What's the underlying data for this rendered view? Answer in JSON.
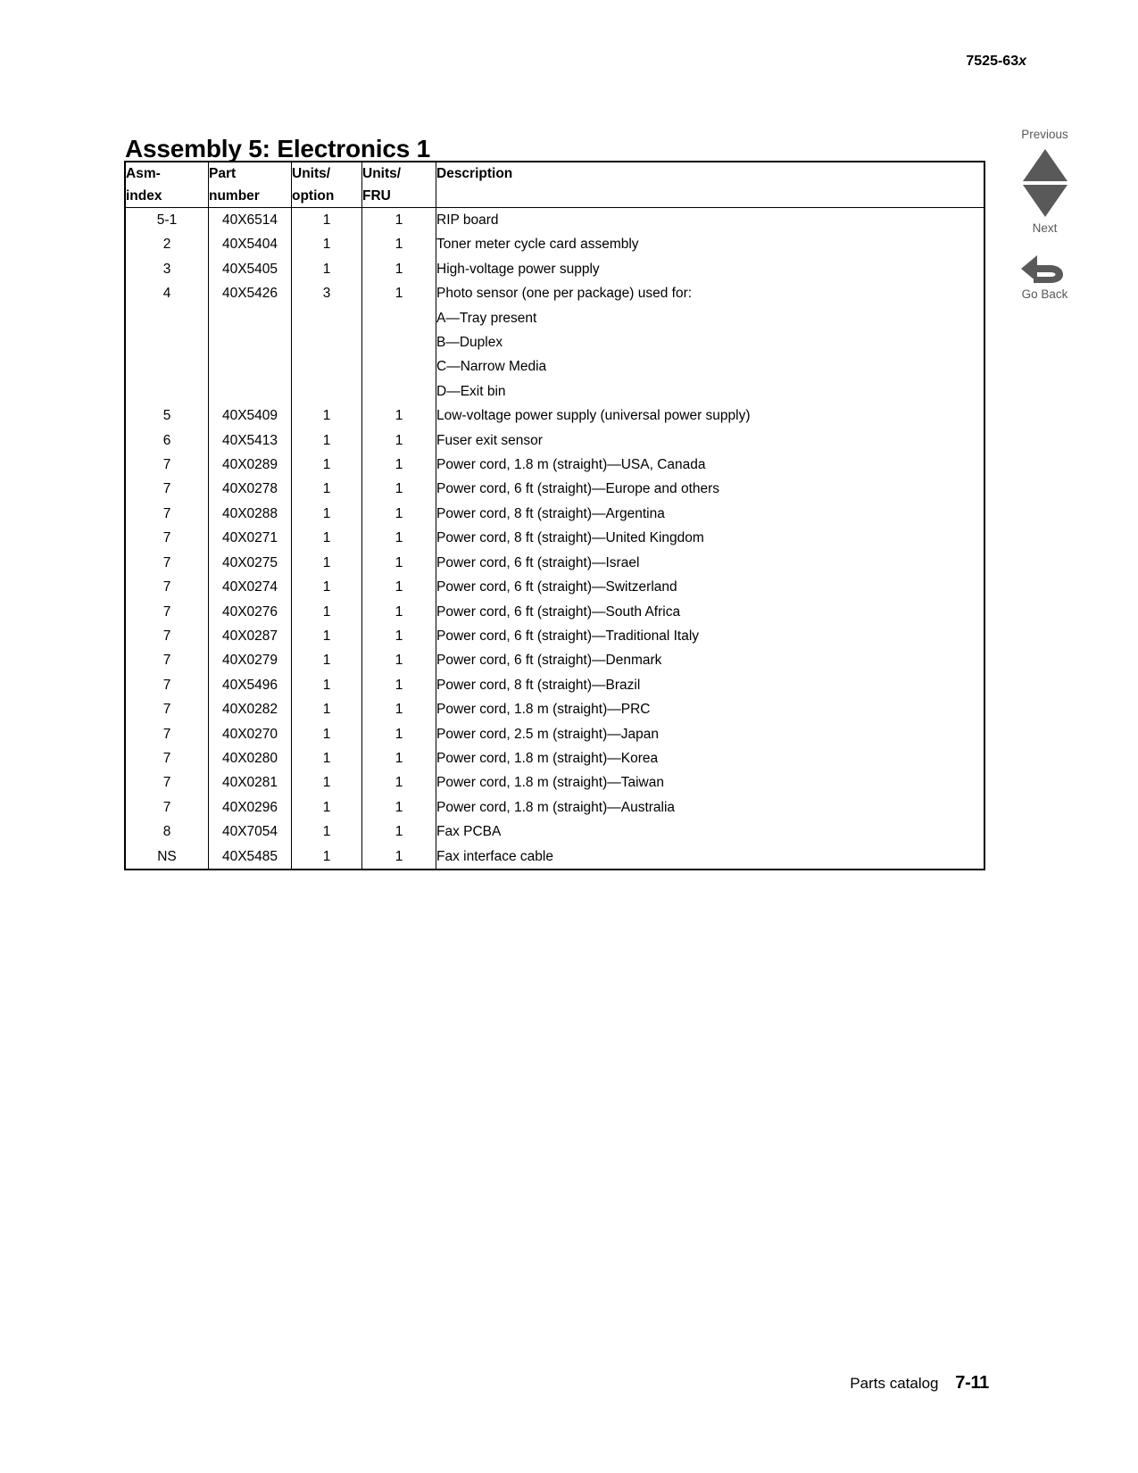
{
  "header": {
    "model_prefix": "7525-63",
    "model_suffix": "x"
  },
  "title": "Assembly 5: Electronics 1",
  "nav": {
    "previous_label": "Previous",
    "next_label": "Next",
    "goback_label": "Go Back",
    "color": "#595959"
  },
  "table": {
    "columns": [
      {
        "key": "asm",
        "label": "Asm-\nindex"
      },
      {
        "key": "part",
        "label": "Part\nnumber"
      },
      {
        "key": "uopt",
        "label": "Units/\noption"
      },
      {
        "key": "ufru",
        "label": "Units/\nFRU"
      },
      {
        "key": "desc",
        "label": "Description"
      }
    ],
    "rows": [
      {
        "asm": "5-1",
        "part": "40X6514",
        "uopt": "1",
        "ufru": "1",
        "desc": "RIP board"
      },
      {
        "asm": "2",
        "part": "40X5404",
        "uopt": "1",
        "ufru": "1",
        "desc": "Toner meter cycle card assembly"
      },
      {
        "asm": "3",
        "part": "40X5405",
        "uopt": "1",
        "ufru": "1",
        "desc": "High-voltage power supply"
      },
      {
        "asm": "4",
        "part": "40X5426",
        "uopt": "3",
        "ufru": "1",
        "desc": "Photo sensor (one per package) used for:"
      },
      {
        "asm": "",
        "part": "",
        "uopt": "",
        "ufru": "",
        "desc": "A—Tray present"
      },
      {
        "asm": "",
        "part": "",
        "uopt": "",
        "ufru": "",
        "desc": "B—Duplex"
      },
      {
        "asm": "",
        "part": "",
        "uopt": "",
        "ufru": "",
        "desc": "C—Narrow Media"
      },
      {
        "asm": "",
        "part": "",
        "uopt": "",
        "ufru": "",
        "desc": "D—Exit bin"
      },
      {
        "asm": "5",
        "part": "40X5409",
        "uopt": "1",
        "ufru": "1",
        "desc": "Low-voltage power supply (universal power supply)"
      },
      {
        "asm": "6",
        "part": "40X5413",
        "uopt": "1",
        "ufru": "1",
        "desc": "Fuser exit sensor"
      },
      {
        "asm": "7",
        "part": "40X0289",
        "uopt": "1",
        "ufru": "1",
        "desc": "Power cord, 1.8 m (straight)—USA, Canada"
      },
      {
        "asm": "7",
        "part": "40X0278",
        "uopt": "1",
        "ufru": "1",
        "desc": "Power cord, 6 ft (straight)—Europe and others"
      },
      {
        "asm": "7",
        "part": "40X0288",
        "uopt": "1",
        "ufru": "1",
        "desc": "Power cord, 8 ft (straight)—Argentina"
      },
      {
        "asm": "7",
        "part": "40X0271",
        "uopt": "1",
        "ufru": "1",
        "desc": "Power cord, 8 ft (straight)—United Kingdom"
      },
      {
        "asm": "7",
        "part": "40X0275",
        "uopt": "1",
        "ufru": "1",
        "desc": "Power cord, 6 ft (straight)—Israel"
      },
      {
        "asm": "7",
        "part": "40X0274",
        "uopt": "1",
        "ufru": "1",
        "desc": "Power cord, 6 ft (straight)—Switzerland"
      },
      {
        "asm": "7",
        "part": "40X0276",
        "uopt": "1",
        "ufru": "1",
        "desc": "Power cord, 6 ft (straight)—South Africa"
      },
      {
        "asm": "7",
        "part": "40X0287",
        "uopt": "1",
        "ufru": "1",
        "desc": "Power cord, 6 ft (straight)—Traditional Italy"
      },
      {
        "asm": "7",
        "part": "40X0279",
        "uopt": "1",
        "ufru": "1",
        "desc": "Power cord, 6 ft (straight)—Denmark"
      },
      {
        "asm": "7",
        "part": "40X5496",
        "uopt": "1",
        "ufru": "1",
        "desc": "Power cord, 8 ft (straight)—Brazil"
      },
      {
        "asm": "7",
        "part": "40X0282",
        "uopt": "1",
        "ufru": "1",
        "desc": "Power cord, 1.8 m (straight)—PRC"
      },
      {
        "asm": "7",
        "part": "40X0270",
        "uopt": "1",
        "ufru": "1",
        "desc": "Power cord, 2.5 m (straight)—Japan"
      },
      {
        "asm": "7",
        "part": "40X0280",
        "uopt": "1",
        "ufru": "1",
        "desc": "Power cord, 1.8 m (straight)—Korea"
      },
      {
        "asm": "7",
        "part": "40X0281",
        "uopt": "1",
        "ufru": "1",
        "desc": "Power cord, 1.8 m (straight)—Taiwan"
      },
      {
        "asm": "7",
        "part": "40X0296",
        "uopt": "1",
        "ufru": "1",
        "desc": "Power cord, 1.8 m (straight)—Australia"
      },
      {
        "asm": "8",
        "part": "40X7054",
        "uopt": "1",
        "ufru": "1",
        "desc": "Fax PCBA"
      },
      {
        "asm": "NS",
        "part": "40X5485",
        "uopt": "1",
        "ufru": "1",
        "desc": "Fax interface cable"
      }
    ]
  },
  "footer": {
    "label": "Parts catalog",
    "page": "7-11"
  }
}
